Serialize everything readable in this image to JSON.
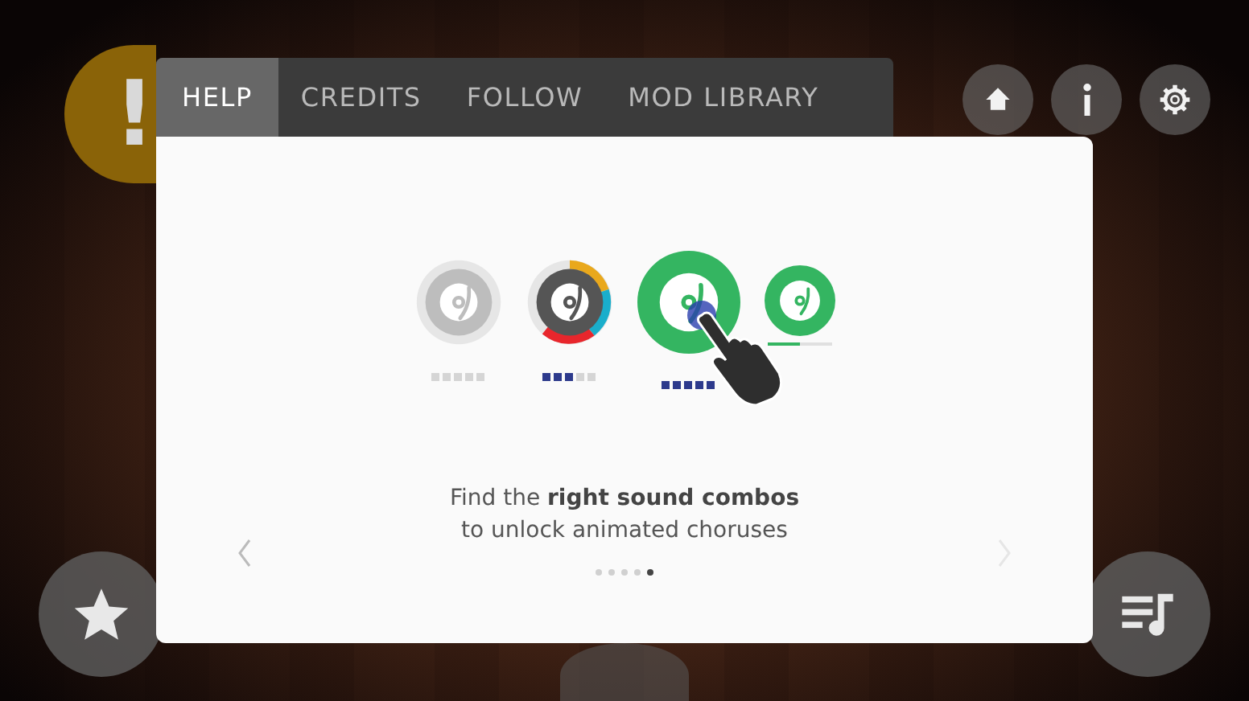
{
  "alert_badge": {
    "label": "!"
  },
  "tabs": [
    {
      "label": "HELP",
      "selected": true
    },
    {
      "label": "CREDITS",
      "selected": false
    },
    {
      "label": "FOLLOW",
      "selected": false
    },
    {
      "label": "MOD LIBRARY",
      "selected": false
    }
  ],
  "top_buttons": [
    {
      "kind": "home"
    },
    {
      "kind": "info"
    },
    {
      "kind": "settings"
    }
  ],
  "discs": [
    {
      "kind": "idle",
      "level": 0
    },
    {
      "kind": "mixing",
      "level": 0.6
    },
    {
      "kind": "tapped",
      "level": 1
    },
    {
      "kind": "loading",
      "level": 0.5
    }
  ],
  "caption": [
    "Find the **right sound combos**",
    "to unlock animated choruses"
  ],
  "pager": [
    {
      "selected": false
    },
    {
      "selected": false
    },
    {
      "selected": false
    },
    {
      "selected": false
    },
    {
      "selected": true
    }
  ],
  "corner_buttons": [
    {
      "kind": "favorites"
    },
    {
      "kind": "playlist"
    }
  ]
}
